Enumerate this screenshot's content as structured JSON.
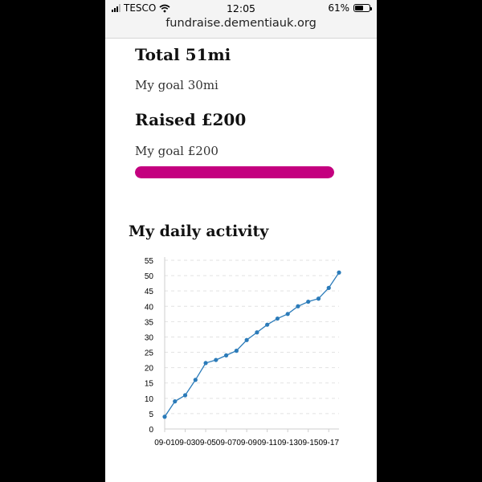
{
  "status_bar": {
    "carrier": "TESCO",
    "time": "12:05",
    "battery": "61%",
    "battery_level": 0.61,
    "url": "fundraise.dementiauk.org"
  },
  "summary": {
    "total": "Total 51mi",
    "distance_goal": "My goal 30mi",
    "raised": "Raised £200",
    "money_goal": "My goal £200",
    "progress_percent": 100,
    "progress_color": "#c4007f"
  },
  "activity": {
    "title": "My daily activity"
  },
  "chart_data": {
    "type": "line",
    "x": [
      "09-01",
      "09-02",
      "09-03",
      "09-04",
      "09-05",
      "09-06",
      "09-07",
      "09-08",
      "09-09",
      "09-10",
      "09-11",
      "09-12",
      "09-13",
      "09-14",
      "09-15",
      "09-16",
      "09-17",
      "09-18"
    ],
    "x_tick_labels": [
      "09-01",
      "09-03",
      "09-05",
      "09-07",
      "09-09",
      "09-11",
      "09-13",
      "09-15",
      "09-17"
    ],
    "series": [
      {
        "values": [
          4,
          9,
          11,
          16,
          21.5,
          22.5,
          24,
          25.5,
          29,
          31.5,
          34,
          36,
          37.5,
          40,
          41.5,
          42.5,
          46,
          51
        ],
        "color": "#2b7bb9"
      }
    ],
    "y_ticks": [
      0,
      5,
      10,
      15,
      20,
      25,
      30,
      35,
      40,
      45,
      50,
      55
    ],
    "ylim": [
      0,
      55
    ],
    "grid": true,
    "legend": "none"
  }
}
